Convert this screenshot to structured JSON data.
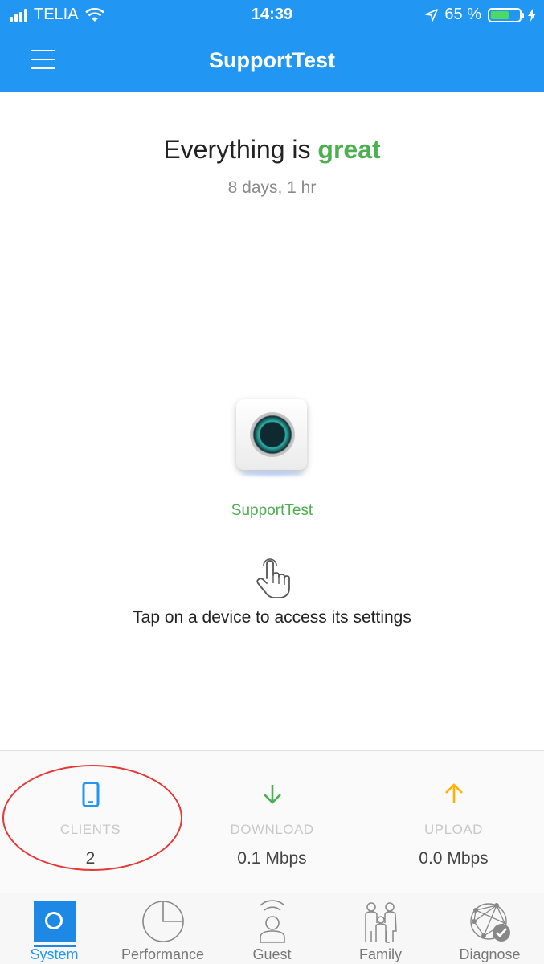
{
  "status_bar": {
    "carrier": "TELIA",
    "time": "14:39",
    "battery_percent": "65 %",
    "battery_level": 0.65
  },
  "nav": {
    "title": "SupportTest",
    "menu_icon": "hamburger-menu-icon"
  },
  "summary": {
    "headline_prefix": "Everything is",
    "headline_status": "great",
    "uptime": "8 days, 1 hr"
  },
  "device": {
    "name": "SupportTest",
    "hint": "Tap on a device to access its settings"
  },
  "stats": {
    "clients": {
      "label": "CLIENTS",
      "value": "2",
      "icon": "phone-icon",
      "color": "#2196f3"
    },
    "download": {
      "label": "DOWNLOAD",
      "value": "0.1 Mbps",
      "icon": "arrow-down-icon",
      "color": "#4caf50"
    },
    "upload": {
      "label": "UPLOAD",
      "value": "0.0 Mbps",
      "icon": "arrow-up-icon",
      "color": "#ffb300"
    }
  },
  "tabs": [
    {
      "label": "System",
      "icon": "system-icon",
      "active": true
    },
    {
      "label": "Performance",
      "icon": "pie-chart-icon",
      "active": false
    },
    {
      "label": "Guest",
      "icon": "guest-wifi-icon",
      "active": false
    },
    {
      "label": "Family",
      "icon": "family-icon",
      "active": false
    },
    {
      "label": "Diagnose",
      "icon": "diagnose-network-icon",
      "active": false
    }
  ],
  "colors": {
    "accent": "#2196f3",
    "good": "#4caf50",
    "annotation": "#e53935"
  }
}
